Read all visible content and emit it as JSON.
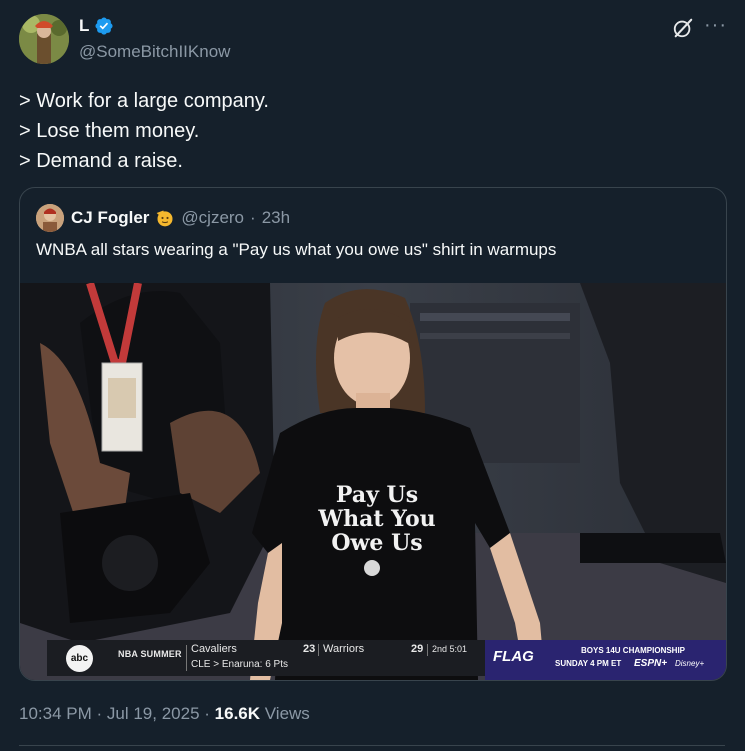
{
  "author": {
    "name": "L",
    "handle": "@SomeBitchIIKnow",
    "verified": true,
    "avatar": "avatar-image"
  },
  "icons": {
    "grok": "grok-icon",
    "more": "more-icon",
    "more_glyph": "···"
  },
  "tweet": {
    "lines": [
      "> Work for a large company.",
      "> Lose them money.",
      "> Demand a raise."
    ]
  },
  "quote": {
    "name": "CJ Fogler",
    "handle": "@cjzero",
    "separator": "·",
    "time": "23h",
    "text": "WNBA all stars wearing a \"Pay us what you owe us\" shirt in warmups",
    "media": {
      "shirt_lines": [
        "Pay Us",
        "What You",
        "Owe Us"
      ],
      "scorebar": {
        "network": "abc",
        "league": "NBA SUMMER",
        "team1": "Cavaliers",
        "score1": "23",
        "team2": "Warriors",
        "score2": "29",
        "clock": "2nd 5:01",
        "sub": "CLE  >  Enaruna: 6 Pts"
      },
      "promo": {
        "brand": "FLAG",
        "line1": "BOYS 14U CHAMPIONSHIP",
        "line2": "SUNDAY 4 PM ET",
        "espn": "ESPN+",
        "disney": "Disney+"
      }
    }
  },
  "footer": {
    "time": "10:34 PM",
    "date": "Jul 19, 2025",
    "views_count": "16.6K",
    "views_label": "Views"
  },
  "colors": {
    "background": "#15202b",
    "verified_blue": "#1d9bf0",
    "secondary_text": "#8b98a5",
    "border": "#38444d"
  }
}
